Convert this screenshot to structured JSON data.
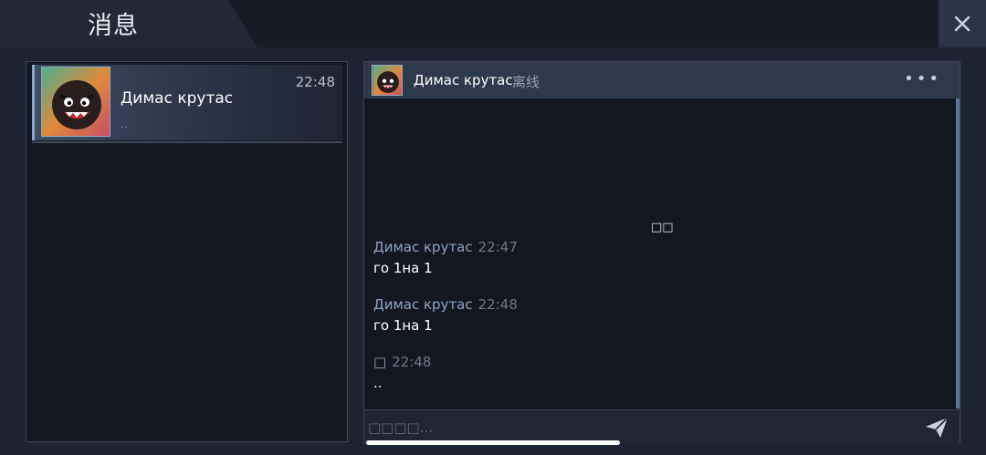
{
  "header": {
    "title": "消息",
    "close_icon": "close-icon"
  },
  "conversations": [
    {
      "name": "Димас крутас",
      "time": "22:48",
      "preview": "..",
      "avatar_icon": "angry-ball-avatar"
    }
  ],
  "chat": {
    "contact_name": "Димас крутас",
    "status": "离线",
    "more_label": "•••",
    "date_divider": "□□",
    "messages": [
      {
        "sender": "Димас крутас",
        "time": "22:47",
        "text": "го 1на 1"
      },
      {
        "sender": "Димас крутас",
        "time": "22:48",
        "text": "го 1на 1"
      },
      {
        "sender": "□",
        "time": "22:48",
        "text": ".."
      }
    ],
    "input_placeholder": "□□□□...",
    "send_icon": "paper-plane-icon"
  },
  "colors": {
    "background": "#1b2430",
    "panel": "#121820",
    "header_bar": "#2d3a4b",
    "accent": "#8ea4c2"
  }
}
